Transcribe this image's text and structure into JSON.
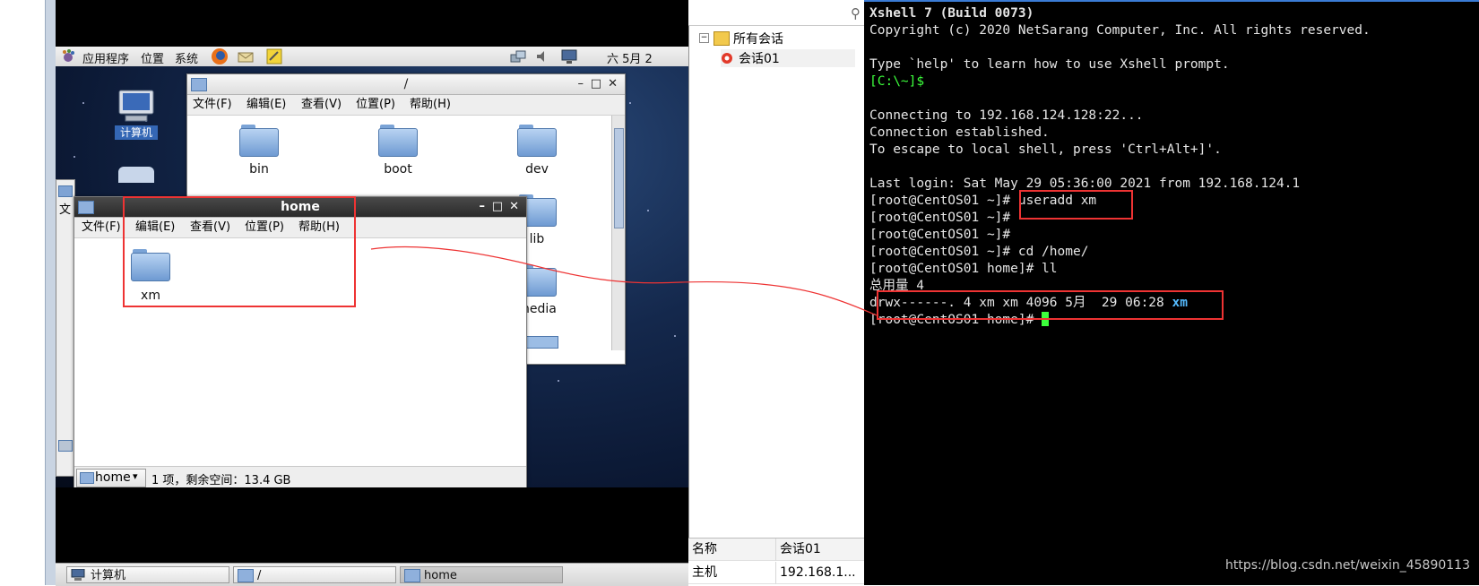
{
  "vm": {
    "panel": {
      "menus": [
        "应用程序",
        "位置",
        "系统"
      ],
      "clock": "六 5月 2"
    },
    "desktop_icons": [
      {
        "label": "计算机",
        "icon": "computer-icon"
      }
    ],
    "root_window": {
      "title": "/",
      "menu": [
        "文件(F)",
        "编辑(E)",
        "查看(V)",
        "位置(P)",
        "帮助(H)"
      ],
      "folders": [
        "bin",
        "boot",
        "dev",
        "lib",
        "media"
      ]
    },
    "home_window": {
      "title": "home",
      "menu": [
        "文件(F)",
        "编辑(E)",
        "查看(V)",
        "位置(P)",
        "帮助(H)"
      ],
      "folders": [
        "xm"
      ],
      "location": "home",
      "status": "1 项，剩余空间：13.4 GB"
    },
    "taskbar": [
      {
        "label": "计算机",
        "icon": "computer-icon",
        "active": false
      },
      {
        "label": "/",
        "icon": "folder-icon",
        "active": false
      },
      {
        "label": "home",
        "icon": "folder-icon",
        "active": true
      }
    ],
    "side_partial_label": "文"
  },
  "xshell": {
    "tree": {
      "root": "所有会话",
      "child": "会话01"
    },
    "properties": [
      {
        "key": "名称",
        "value": "会话01"
      },
      {
        "key": "主机",
        "value": "192.168.1..."
      }
    ],
    "terminal": {
      "lines": [
        {
          "text": "Xshell 7 (Build 0073)",
          "style": "bold"
        },
        {
          "text": "Copyright (c) 2020 NetSarang Computer, Inc. All rights reserved.",
          "style": ""
        },
        {
          "text": "",
          "style": ""
        },
        {
          "text": "Type `help' to learn how to use Xshell prompt.",
          "style": ""
        },
        {
          "text": "[C:\\~]$",
          "style": "green"
        },
        {
          "text": "",
          "style": ""
        },
        {
          "text": "Connecting to 192.168.124.128:22...",
          "style": ""
        },
        {
          "text": "Connection established.",
          "style": ""
        },
        {
          "text": "To escape to local shell, press 'Ctrl+Alt+]'.",
          "style": ""
        },
        {
          "text": "",
          "style": ""
        },
        {
          "text": "Last login: Sat May 29 05:36:00 2021 from 192.168.124.1",
          "style": ""
        },
        {
          "text": "[root@CentOS01 ~]# useradd xm",
          "style": ""
        },
        {
          "text": "[root@CentOS01 ~]#",
          "style": ""
        },
        {
          "text": "[root@CentOS01 ~]#",
          "style": ""
        },
        {
          "text": "[root@CentOS01 ~]# cd /home/",
          "style": ""
        },
        {
          "text": "[root@CentOS01 home]# ll",
          "style": ""
        },
        {
          "text": "总用量 4",
          "style": ""
        }
      ],
      "ls_line_prefix": "drwx------. 4 xm xm 4096 5月  29 06:28 ",
      "ls_line_name": "xm",
      "prompt_last": "[root@CentOS01 home]# "
    },
    "colors": {
      "prompt_green": "#3cff3c",
      "dir_blue": "#55bbff",
      "highlight_red": "#ee3333"
    }
  },
  "watermark": "https://blog.csdn.net/weixin_45890113"
}
